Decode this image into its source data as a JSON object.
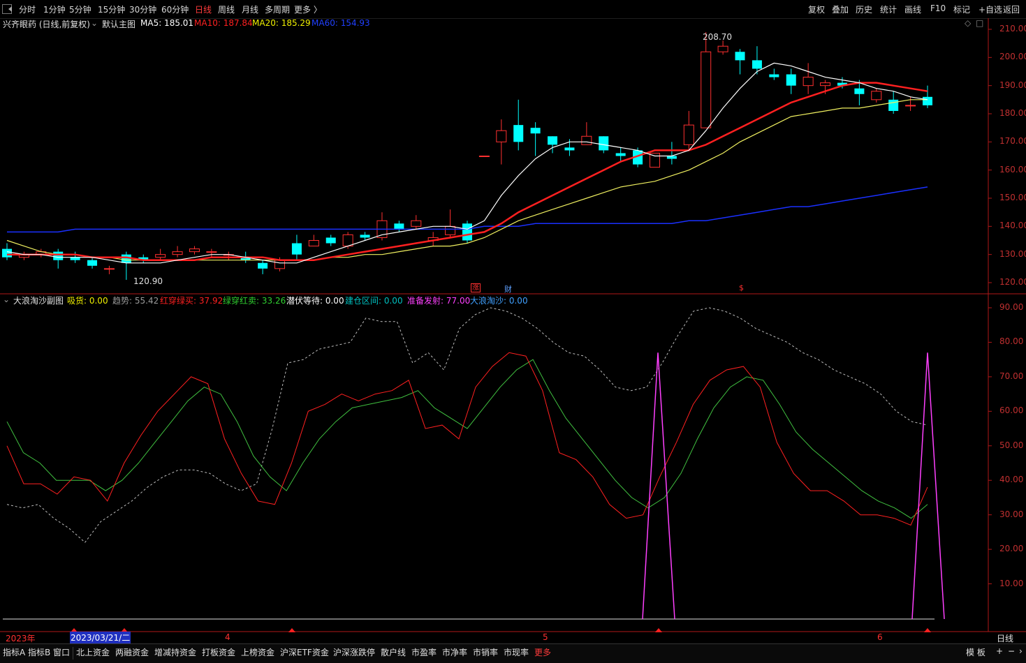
{
  "toolbar": {
    "periods": [
      "分时",
      "1分钟",
      "5分钟",
      "15分钟",
      "30分钟",
      "60分钟",
      "日线",
      "周线",
      "月线",
      "多周期",
      "更多 〉"
    ],
    "active_period": "日线",
    "right_buttons": [
      "复权",
      "叠加",
      "历史",
      "统计",
      "画线",
      "F10",
      "标记",
      "+自选",
      "返回"
    ]
  },
  "main_panel": {
    "stock": "兴齐眼药 (日线,前复权)",
    "template": "默认主图",
    "ma": [
      {
        "label": "MA5: 185.01",
        "color": "#ffffff"
      },
      {
        "label": "MA10: 187.84",
        "color": "#ff2020"
      },
      {
        "label": "MA20: 185.29",
        "color": "#f0f000"
      },
      {
        "label": "MA60: 154.93",
        "color": "#2040ff"
      }
    ],
    "high_label": "208.70",
    "low_label": "120.90",
    "y_ticks": [
      "210.00",
      "200.00",
      "190.00",
      "180.00",
      "170.00",
      "160.00",
      "150.00",
      "140.00",
      "130.00",
      "120.00"
    ],
    "event_marks": [
      "涨",
      "财",
      "$"
    ]
  },
  "sub_panel": {
    "title": "大浪淘沙副图",
    "indicators": [
      {
        "label": "吸货: 0.00",
        "color": "#f0f000"
      },
      {
        "label": "趋势: 55.42",
        "color": "#9a9a9a"
      },
      {
        "label": "红穿绿买: 37.92",
        "color": "#ff2020"
      },
      {
        "label": "绿穿红卖: 33.26",
        "color": "#30d030"
      },
      {
        "label": "潜伏等待: 0.00",
        "color": "#ffffff"
      },
      {
        "label": "建仓区间: 0.00",
        "color": "#00c0c0"
      },
      {
        "label": "准备发射: 77.00",
        "color": "#ff40ff"
      },
      {
        "label": "大浪淘沙: 0.00",
        "color": "#40a0ff"
      }
    ],
    "y_ticks": [
      "90.00",
      "80.00",
      "70.00",
      "60.00",
      "50.00",
      "40.00",
      "30.00",
      "20.00",
      "10.00"
    ]
  },
  "time_axis": {
    "year_label": "2023年",
    "cursor_date": "2023/03/21/二",
    "month_labels": [
      "4",
      "5",
      "6"
    ],
    "period_label": "日线"
  },
  "bottom_tabs": [
    "指标A",
    "指标B",
    "窗口",
    "北上资金",
    "两融资金",
    "增减持资金",
    "打板资金",
    "上榜资金",
    "沪深ETF资金",
    "沪深涨跌停",
    "散户线",
    "市盈率",
    "市净率",
    "市销率",
    "市现率",
    "更多"
  ],
  "bottom_right": [
    "模 板",
    "+",
    "−",
    "›"
  ],
  "chart_data": {
    "type": "candlestick",
    "main_ylim": [
      118,
      212
    ],
    "candles": [
      [
        132,
        129,
        134,
        128
      ],
      [
        129,
        130,
        131,
        128
      ],
      [
        130,
        131,
        132,
        129
      ],
      [
        131,
        128,
        132,
        125
      ],
      [
        129,
        128,
        131,
        127
      ],
      [
        128,
        126,
        129,
        125
      ],
      [
        125,
        125,
        126,
        123
      ],
      [
        130,
        127,
        131,
        121
      ],
      [
        129,
        128,
        130,
        127
      ],
      [
        129,
        130,
        132,
        128
      ],
      [
        130,
        131,
        133,
        129
      ],
      [
        131,
        132,
        133,
        130
      ],
      [
        131,
        131,
        132,
        129
      ],
      [
        130,
        130,
        131,
        128
      ],
      [
        129,
        128,
        131,
        127
      ],
      [
        127,
        125,
        128,
        123
      ],
      [
        125,
        128,
        129,
        124
      ],
      [
        134,
        130,
        137,
        128
      ],
      [
        133,
        135,
        137,
        133
      ],
      [
        136,
        134,
        137,
        133
      ],
      [
        133,
        137,
        138,
        132
      ],
      [
        137,
        136,
        138,
        135
      ],
      [
        136,
        142,
        145,
        135
      ],
      [
        141,
        139,
        142,
        138
      ],
      [
        140,
        142,
        144,
        139
      ],
      [
        135,
        136,
        138,
        133
      ],
      [
        137,
        140,
        146,
        136
      ],
      [
        141,
        135,
        142,
        134
      ],
      [
        165,
        165,
        165,
        165
      ],
      [
        170,
        174,
        178,
        162
      ],
      [
        176,
        170,
        185,
        167
      ],
      [
        175,
        173,
        177,
        165
      ],
      [
        172,
        169,
        172,
        166
      ],
      [
        168,
        167,
        171,
        165
      ],
      [
        169,
        172,
        177,
        170
      ],
      [
        172,
        167,
        172,
        166
      ],
      [
        166,
        165,
        168,
        163
      ],
      [
        167,
        162,
        168,
        161
      ],
      [
        161,
        166,
        166,
        161
      ],
      [
        165,
        164,
        170,
        162
      ],
      [
        169,
        176,
        181,
        167
      ],
      [
        175,
        202,
        209,
        175
      ],
      [
        202,
        204,
        206,
        201
      ],
      [
        202,
        199,
        203,
        194
      ],
      [
        199,
        196,
        204,
        194
      ],
      [
        194,
        193,
        196,
        192
      ],
      [
        194,
        190,
        196,
        187
      ],
      [
        190,
        193,
        198,
        187
      ],
      [
        190,
        191,
        192,
        187
      ],
      [
        191,
        190,
        193,
        189
      ],
      [
        189,
        187,
        192,
        183
      ],
      [
        185,
        188,
        189,
        184
      ],
      [
        185,
        181,
        188,
        180
      ],
      [
        183,
        183,
        186,
        181
      ],
      [
        186,
        183,
        190,
        182
      ]
    ],
    "ma5": [
      131,
      130,
      130,
      129,
      129,
      129,
      128,
      127,
      127,
      127,
      128,
      129,
      130,
      130,
      129,
      128,
      127,
      127,
      129,
      131,
      133,
      135,
      137,
      138,
      139,
      140,
      140,
      139,
      142,
      151,
      158,
      164,
      168,
      170,
      170,
      169,
      168,
      167,
      165,
      165,
      167,
      174,
      182,
      189,
      195,
      198,
      197,
      195,
      193,
      192,
      191,
      189,
      188,
      186,
      185
    ],
    "ma10": [
      130,
      130,
      130,
      130,
      130,
      129,
      129,
      129,
      128,
      128,
      128,
      128,
      129,
      129,
      129,
      129,
      128,
      128,
      128,
      129,
      130,
      131,
      132,
      133,
      134,
      135,
      136,
      137,
      138,
      141,
      145,
      148,
      151,
      154,
      157,
      160,
      163,
      165,
      167,
      167,
      167,
      169,
      172,
      175,
      178,
      181,
      184,
      186,
      188,
      190,
      191,
      191,
      190,
      189,
      188
    ],
    "ma20": [
      135,
      133,
      131,
      130,
      130,
      129,
      129,
      128,
      128,
      128,
      128,
      128,
      128,
      128,
      128,
      128,
      128,
      128,
      128,
      129,
      129,
      130,
      130,
      131,
      132,
      133,
      133,
      134,
      136,
      139,
      142,
      144,
      146,
      148,
      150,
      152,
      154,
      155,
      156,
      158,
      160,
      163,
      166,
      170,
      173,
      176,
      179,
      180,
      181,
      182,
      182,
      183,
      184,
      185,
      185
    ],
    "ma60": [
      138,
      138,
      138,
      138,
      139,
      139,
      139,
      139,
      139,
      139,
      139,
      139,
      139,
      139,
      139,
      139,
      139,
      139,
      139,
      139,
      139,
      139,
      139,
      139,
      139,
      139,
      139,
      139,
      140,
      140,
      140,
      141,
      141,
      141,
      141,
      141,
      141,
      141,
      141,
      141,
      142,
      142,
      143,
      144,
      145,
      146,
      147,
      147,
      148,
      149,
      150,
      151,
      152,
      153,
      154
    ],
    "sub_ylim": [
      0,
      97
    ],
    "trend": [
      33,
      32,
      33,
      29,
      26,
      22,
      28,
      31,
      34,
      38,
      41,
      43,
      43,
      42,
      39,
      37,
      39,
      55,
      74,
      75,
      78,
      79,
      80,
      87,
      86,
      86,
      74,
      77,
      72,
      84,
      88,
      90,
      89,
      87,
      84,
      80,
      77,
      76,
      72,
      67,
      66,
      67,
      74,
      82,
      89,
      90,
      89,
      87,
      84,
      82,
      80,
      77,
      75,
      72,
      70,
      68,
      65,
      60,
      57,
      56
    ],
    "red_cross": [
      50,
      39,
      39,
      36,
      41,
      40,
      34,
      45,
      53,
      60,
      65,
      70,
      68,
      52,
      42,
      34,
      33,
      45,
      60,
      62,
      65,
      63,
      65,
      66,
      69,
      55,
      56,
      52,
      67,
      73,
      77,
      76,
      66,
      48,
      46,
      41,
      33,
      29,
      30,
      41,
      51,
      62,
      69,
      72,
      73,
      67,
      51,
      42,
      37,
      37,
      34,
      30,
      30,
      29,
      27,
      38
    ],
    "green_cross": [
      57,
      48,
      45,
      40,
      40,
      40,
      37,
      40,
      45,
      51,
      57,
      63,
      67,
      65,
      57,
      47,
      41,
      37,
      45,
      52,
      57,
      61,
      62,
      63,
      64,
      66,
      61,
      58,
      55,
      61,
      67,
      72,
      75,
      66,
      58,
      52,
      46,
      40,
      35,
      32,
      35,
      42,
      52,
      61,
      67,
      70,
      69,
      62,
      54,
      49,
      45,
      41,
      37,
      34,
      32,
      29,
      33
    ],
    "prepare_spikes": [
      [
        942,
        77
      ],
      [
        1328,
        77
      ]
    ]
  }
}
